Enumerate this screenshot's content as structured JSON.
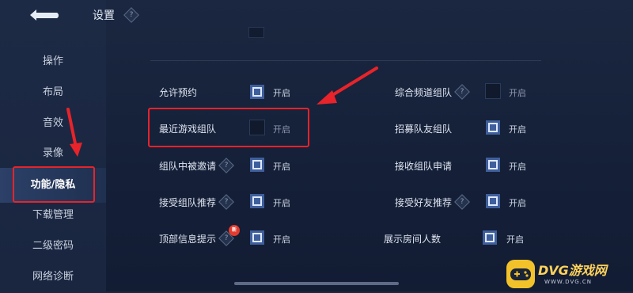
{
  "header": {
    "title": "设置",
    "help_icon": "?"
  },
  "sidebar": {
    "items": [
      {
        "label": "操作"
      },
      {
        "label": "布局"
      },
      {
        "label": "音效"
      },
      {
        "label": "录像"
      },
      {
        "label": "功能/隐私"
      },
      {
        "label": "下载管理"
      },
      {
        "label": "二级密码"
      },
      {
        "label": "网络诊断"
      }
    ],
    "active_index": 4
  },
  "settings": {
    "on_label": "开启",
    "help_glyph": "?",
    "new_badge": "新",
    "left": [
      {
        "label": "允许预约",
        "checked": true
      },
      {
        "label": "最近游戏组队",
        "checked": false
      },
      {
        "label": "组队中被邀请",
        "checked": true
      },
      {
        "label": "接受组队推荐",
        "checked": true
      },
      {
        "label": "顶部信息提示",
        "checked": true
      }
    ],
    "right": [
      {
        "label": "综合频道组队",
        "checked": false
      },
      {
        "label": "招募队友组队",
        "checked": true
      },
      {
        "label": "接收组队申请",
        "checked": true
      },
      {
        "label": "接受好友推荐",
        "checked": true
      },
      {
        "label": "展示房间人数",
        "checked": true
      }
    ]
  },
  "watermark": {
    "title": "DVG游戏网",
    "url": "WWW.DVG.CN"
  },
  "colors": {
    "accent": "#3f5f9c",
    "annotation": "#e8232a"
  }
}
